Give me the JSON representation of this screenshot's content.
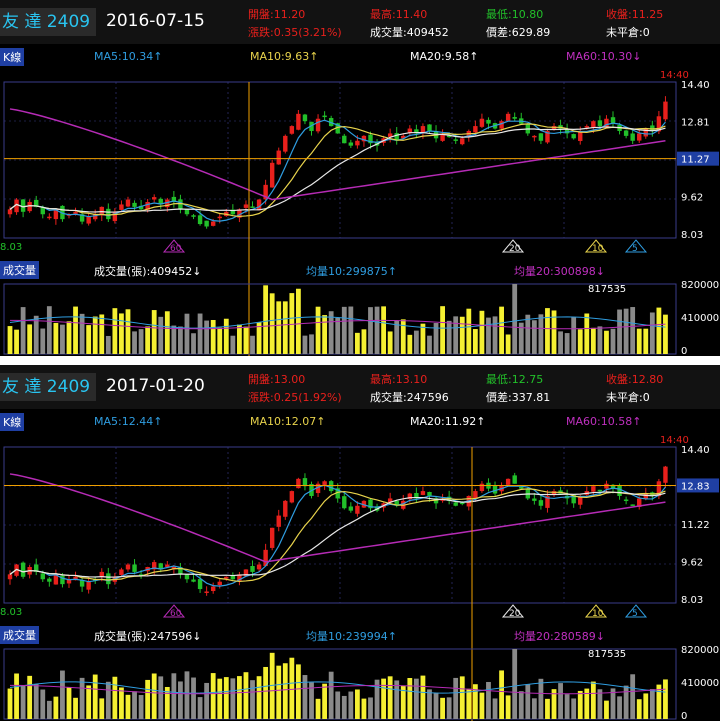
{
  "panels": [
    {
      "stock": "友  達 2409",
      "date": "2016-07-15",
      "open": "開盤:11.20",
      "high": "最高:11.40",
      "low": "最低:10.80",
      "close": "收盤:11.25",
      "change": "漲跌:0.35(3.21%)",
      "volume": "成交量:409452",
      "spread": "價差:629.89",
      "open_interest": "未平倉:0",
      "kline_label": "K線",
      "ma5": "MA5:10.34↑",
      "ma10": "MA10:9.63↑",
      "ma20": "MA20:9.58↑",
      "ma60": "MA60:10.30↓",
      "time_label": "14:40",
      "price_ticks": [
        "14.40",
        "12.81",
        "11.27",
        "9.62",
        "8.03"
      ],
      "current_price": "11.27",
      "low_label": "8.03",
      "markers": [
        "60",
        "20",
        "10",
        "5"
      ],
      "volume_label": "成交量",
      "vol_text": "成交量(張):409452↓",
      "avg10": "均量10:299875↑",
      "avg20": "均量20:300898↓",
      "vol_ticks": [
        "820000",
        "410000",
        "0"
      ],
      "max_vol_label": "817535"
    },
    {
      "stock": "友  達 2409",
      "date": "2017-01-20",
      "open": "開盤:13.00",
      "high": "最高:13.10",
      "low": "最低:12.75",
      "close": "收盤:12.80",
      "change": "漲跌:0.25(1.92%)",
      "volume": "成交量:247596",
      "spread": "價差:337.81",
      "open_interest": "未平倉:0",
      "kline_label": "K線",
      "ma5": "MA5:12.44↑",
      "ma10": "MA10:12.07↑",
      "ma20": "MA20:11.92↑",
      "ma60": "MA60:10.58↑",
      "time_label": "14:40",
      "price_ticks": [
        "14.40",
        "12.83",
        "11.22",
        "9.62",
        "8.03"
      ],
      "current_price": "12.83",
      "low_label": "8.03",
      "markers": [
        "60",
        "20",
        "10",
        "5"
      ],
      "volume_label": "成交量",
      "vol_text": "成交量(張):247596↓",
      "avg10": "均量10:239994↑",
      "avg20": "均量20:280589↓",
      "vol_ticks": [
        "820000",
        "410000",
        "0"
      ],
      "max_vol_label": "817535"
    }
  ],
  "colors": {
    "up": "#e8201c",
    "down": "#22c02a",
    "ma5": "#2f9de0",
    "ma10": "#e8d34c",
    "ma20": "#e8e8e8",
    "ma60": "#b52bb5",
    "crosshair": "#f0a000",
    "grid": "#3a3d8a",
    "vol_up": "#f5f032",
    "vol_down": "#8a8a8a"
  }
}
